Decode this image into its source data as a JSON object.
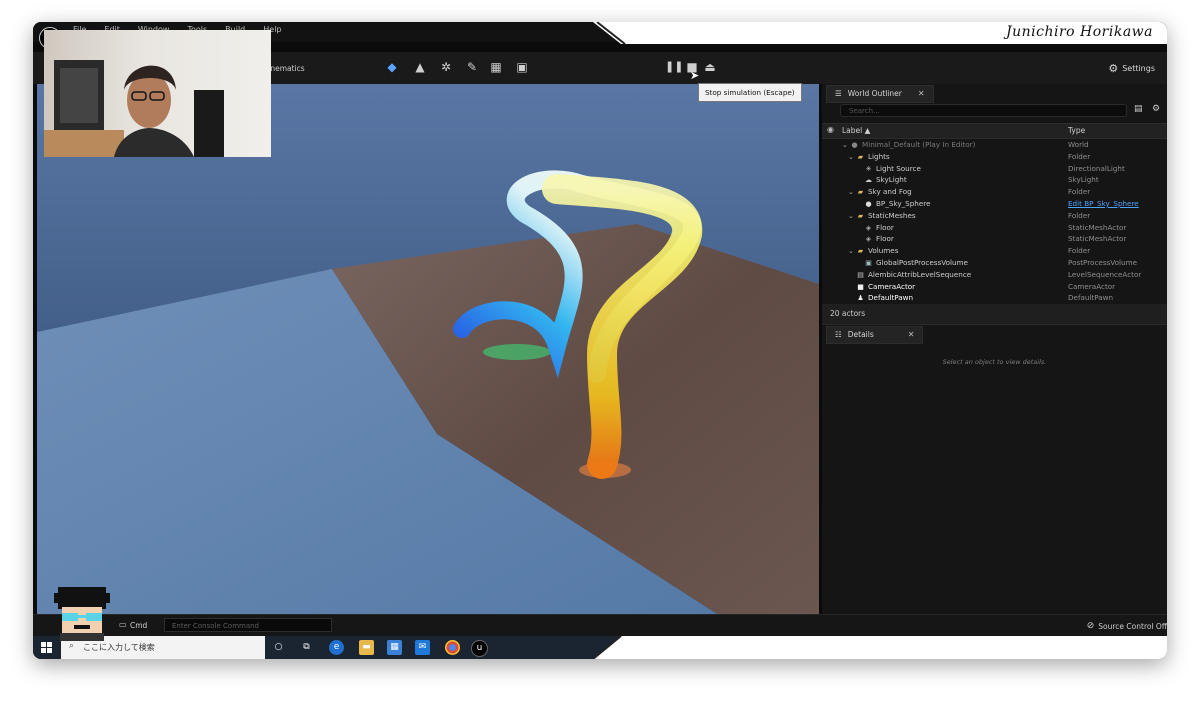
{
  "presenter": {
    "name": "Junichiro Horikawa"
  },
  "menu": {
    "items": [
      "File",
      "Edit",
      "Window",
      "Tools",
      "Build",
      "Help"
    ]
  },
  "toolbar": {
    "cinematics_label": "Cinematics",
    "settings_label": "Settings",
    "tooltip": "Stop simulation (Escape)"
  },
  "outliner": {
    "tab_title": "World Outliner",
    "search_placeholder": "Search...",
    "col_label": "Label ▲",
    "col_type": "Type",
    "rows": [
      {
        "label": "Minimal_Default (Play In Editor)",
        "type": "World"
      },
      {
        "label": "Lights",
        "type": "Folder"
      },
      {
        "label": "Light Source",
        "type": "DirectionalLight"
      },
      {
        "label": "SkyLight",
        "type": "SkyLight"
      },
      {
        "label": "Sky and Fog",
        "type": "Folder"
      },
      {
        "label": "BP_Sky_Sphere",
        "type": "Edit BP_Sky_Sphere"
      },
      {
        "label": "StaticMeshes",
        "type": "Folder"
      },
      {
        "label": "Floor",
        "type": "StaticMeshActor"
      },
      {
        "label": "Floor",
        "type": "StaticMeshActor"
      },
      {
        "label": "Volumes",
        "type": "Folder"
      },
      {
        "label": "GlobalPostProcessVolume",
        "type": "PostProcessVolume"
      },
      {
        "label": "AlembicAttribLevelSequence",
        "type": "LevelSequenceActor"
      },
      {
        "label": "CameraActor",
        "type": "CameraActor"
      },
      {
        "label": "DefaultPawn",
        "type": "DefaultPawn"
      }
    ],
    "actor_count": "20 actors"
  },
  "details": {
    "tab_title": "Details",
    "hint": "Select an object to view details."
  },
  "bottom": {
    "cmd_label": "Cmd",
    "console_placeholder": "Enter Console Command",
    "source_control": "Source Control Off"
  },
  "taskbar": {
    "search_placeholder": "ここに入力して検索"
  },
  "colors": {
    "accent_blue": "#4ea3ff",
    "folder_gold": "#d6b463",
    "panel_bg": "#151515",
    "taskbar_bg": "#1b2431"
  }
}
